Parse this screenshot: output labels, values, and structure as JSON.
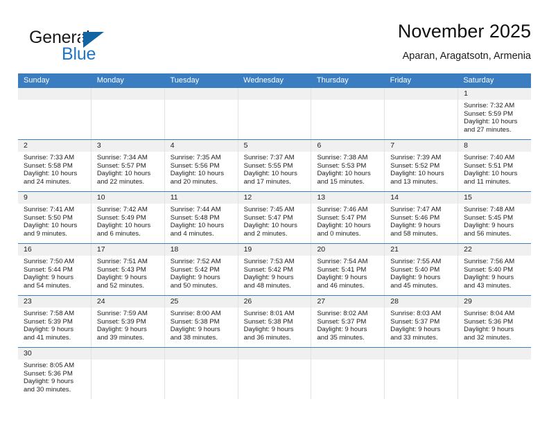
{
  "brand": {
    "name_top": "General",
    "name_bottom": "Blue",
    "accent_color": "#2176c7",
    "triangle_color": "#1264a3"
  },
  "header": {
    "title": "November 2025",
    "subtitle": "Aparan, Aragatsotn, Armenia"
  },
  "calendar": {
    "header_color": "#3a7dc1",
    "daynum_band_color": "#f0f0f0",
    "weekday_headers": [
      "Sunday",
      "Monday",
      "Tuesday",
      "Wednesday",
      "Thursday",
      "Friday",
      "Saturday"
    ],
    "weeks": [
      [
        {
          "day": ""
        },
        {
          "day": ""
        },
        {
          "day": ""
        },
        {
          "day": ""
        },
        {
          "day": ""
        },
        {
          "day": ""
        },
        {
          "day": "1",
          "sunrise": "Sunrise: 7:32 AM",
          "sunset": "Sunset: 5:59 PM",
          "daylight1": "Daylight: 10 hours",
          "daylight2": "and 27 minutes."
        }
      ],
      [
        {
          "day": "2",
          "sunrise": "Sunrise: 7:33 AM",
          "sunset": "Sunset: 5:58 PM",
          "daylight1": "Daylight: 10 hours",
          "daylight2": "and 24 minutes."
        },
        {
          "day": "3",
          "sunrise": "Sunrise: 7:34 AM",
          "sunset": "Sunset: 5:57 PM",
          "daylight1": "Daylight: 10 hours",
          "daylight2": "and 22 minutes."
        },
        {
          "day": "4",
          "sunrise": "Sunrise: 7:35 AM",
          "sunset": "Sunset: 5:56 PM",
          "daylight1": "Daylight: 10 hours",
          "daylight2": "and 20 minutes."
        },
        {
          "day": "5",
          "sunrise": "Sunrise: 7:37 AM",
          "sunset": "Sunset: 5:55 PM",
          "daylight1": "Daylight: 10 hours",
          "daylight2": "and 17 minutes."
        },
        {
          "day": "6",
          "sunrise": "Sunrise: 7:38 AM",
          "sunset": "Sunset: 5:53 PM",
          "daylight1": "Daylight: 10 hours",
          "daylight2": "and 15 minutes."
        },
        {
          "day": "7",
          "sunrise": "Sunrise: 7:39 AM",
          "sunset": "Sunset: 5:52 PM",
          "daylight1": "Daylight: 10 hours",
          "daylight2": "and 13 minutes."
        },
        {
          "day": "8",
          "sunrise": "Sunrise: 7:40 AM",
          "sunset": "Sunset: 5:51 PM",
          "daylight1": "Daylight: 10 hours",
          "daylight2": "and 11 minutes."
        }
      ],
      [
        {
          "day": "9",
          "sunrise": "Sunrise: 7:41 AM",
          "sunset": "Sunset: 5:50 PM",
          "daylight1": "Daylight: 10 hours",
          "daylight2": "and 9 minutes."
        },
        {
          "day": "10",
          "sunrise": "Sunrise: 7:42 AM",
          "sunset": "Sunset: 5:49 PM",
          "daylight1": "Daylight: 10 hours",
          "daylight2": "and 6 minutes."
        },
        {
          "day": "11",
          "sunrise": "Sunrise: 7:44 AM",
          "sunset": "Sunset: 5:48 PM",
          "daylight1": "Daylight: 10 hours",
          "daylight2": "and 4 minutes."
        },
        {
          "day": "12",
          "sunrise": "Sunrise: 7:45 AM",
          "sunset": "Sunset: 5:47 PM",
          "daylight1": "Daylight: 10 hours",
          "daylight2": "and 2 minutes."
        },
        {
          "day": "13",
          "sunrise": "Sunrise: 7:46 AM",
          "sunset": "Sunset: 5:47 PM",
          "daylight1": "Daylight: 10 hours",
          "daylight2": "and 0 minutes."
        },
        {
          "day": "14",
          "sunrise": "Sunrise: 7:47 AM",
          "sunset": "Sunset: 5:46 PM",
          "daylight1": "Daylight: 9 hours",
          "daylight2": "and 58 minutes."
        },
        {
          "day": "15",
          "sunrise": "Sunrise: 7:48 AM",
          "sunset": "Sunset: 5:45 PM",
          "daylight1": "Daylight: 9 hours",
          "daylight2": "and 56 minutes."
        }
      ],
      [
        {
          "day": "16",
          "sunrise": "Sunrise: 7:50 AM",
          "sunset": "Sunset: 5:44 PM",
          "daylight1": "Daylight: 9 hours",
          "daylight2": "and 54 minutes."
        },
        {
          "day": "17",
          "sunrise": "Sunrise: 7:51 AM",
          "sunset": "Sunset: 5:43 PM",
          "daylight1": "Daylight: 9 hours",
          "daylight2": "and 52 minutes."
        },
        {
          "day": "18",
          "sunrise": "Sunrise: 7:52 AM",
          "sunset": "Sunset: 5:42 PM",
          "daylight1": "Daylight: 9 hours",
          "daylight2": "and 50 minutes."
        },
        {
          "day": "19",
          "sunrise": "Sunrise: 7:53 AM",
          "sunset": "Sunset: 5:42 PM",
          "daylight1": "Daylight: 9 hours",
          "daylight2": "and 48 minutes."
        },
        {
          "day": "20",
          "sunrise": "Sunrise: 7:54 AM",
          "sunset": "Sunset: 5:41 PM",
          "daylight1": "Daylight: 9 hours",
          "daylight2": "and 46 minutes."
        },
        {
          "day": "21",
          "sunrise": "Sunrise: 7:55 AM",
          "sunset": "Sunset: 5:40 PM",
          "daylight1": "Daylight: 9 hours",
          "daylight2": "and 45 minutes."
        },
        {
          "day": "22",
          "sunrise": "Sunrise: 7:56 AM",
          "sunset": "Sunset: 5:40 PM",
          "daylight1": "Daylight: 9 hours",
          "daylight2": "and 43 minutes."
        }
      ],
      [
        {
          "day": "23",
          "sunrise": "Sunrise: 7:58 AM",
          "sunset": "Sunset: 5:39 PM",
          "daylight1": "Daylight: 9 hours",
          "daylight2": "and 41 minutes."
        },
        {
          "day": "24",
          "sunrise": "Sunrise: 7:59 AM",
          "sunset": "Sunset: 5:39 PM",
          "daylight1": "Daylight: 9 hours",
          "daylight2": "and 39 minutes."
        },
        {
          "day": "25",
          "sunrise": "Sunrise: 8:00 AM",
          "sunset": "Sunset: 5:38 PM",
          "daylight1": "Daylight: 9 hours",
          "daylight2": "and 38 minutes."
        },
        {
          "day": "26",
          "sunrise": "Sunrise: 8:01 AM",
          "sunset": "Sunset: 5:38 PM",
          "daylight1": "Daylight: 9 hours",
          "daylight2": "and 36 minutes."
        },
        {
          "day": "27",
          "sunrise": "Sunrise: 8:02 AM",
          "sunset": "Sunset: 5:37 PM",
          "daylight1": "Daylight: 9 hours",
          "daylight2": "and 35 minutes."
        },
        {
          "day": "28",
          "sunrise": "Sunrise: 8:03 AM",
          "sunset": "Sunset: 5:37 PM",
          "daylight1": "Daylight: 9 hours",
          "daylight2": "and 33 minutes."
        },
        {
          "day": "29",
          "sunrise": "Sunrise: 8:04 AM",
          "sunset": "Sunset: 5:36 PM",
          "daylight1": "Daylight: 9 hours",
          "daylight2": "and 32 minutes."
        }
      ],
      [
        {
          "day": "30",
          "sunrise": "Sunrise: 8:05 AM",
          "sunset": "Sunset: 5:36 PM",
          "daylight1": "Daylight: 9 hours",
          "daylight2": "and 30 minutes."
        },
        {
          "day": ""
        },
        {
          "day": ""
        },
        {
          "day": ""
        },
        {
          "day": ""
        },
        {
          "day": ""
        },
        {
          "day": ""
        }
      ]
    ]
  }
}
